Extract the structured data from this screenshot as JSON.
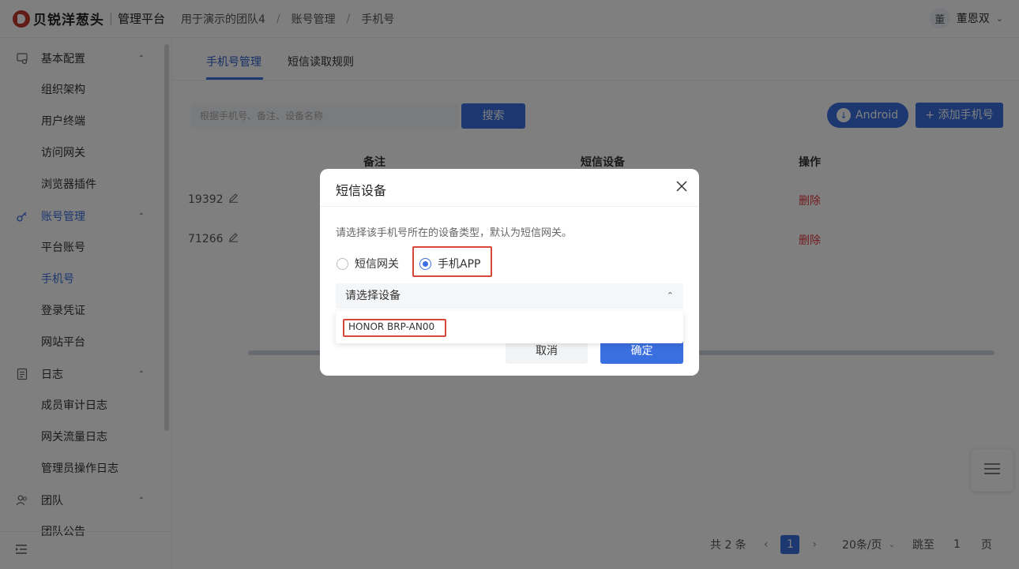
{
  "header": {
    "logo_text": "贝锐洋葱头",
    "logo_sub": "管理平台",
    "breadcrumbs": [
      "用于演示的团队4",
      "账号管理",
      "手机号"
    ],
    "user_avatar": "董",
    "user_name": "董恩双"
  },
  "sidebar": {
    "groups": [
      {
        "label": "基本配置",
        "icon": "settings-icon",
        "items": [
          "组织架构",
          "用户终端",
          "访问网关",
          "浏览器插件"
        ]
      },
      {
        "label": "账号管理",
        "icon": "key-icon",
        "items": [
          "平台账号",
          "手机号",
          "登录凭证",
          "网站平台"
        ]
      },
      {
        "label": "日志",
        "icon": "log-icon",
        "items": [
          "成员审计日志",
          "网关流量日志",
          "管理员操作日志"
        ]
      },
      {
        "label": "团队",
        "icon": "team-icon",
        "items": [
          "团队公告"
        ]
      }
    ],
    "active_group": "账号管理",
    "active_item": "手机号"
  },
  "main": {
    "tabs": [
      "手机号管理",
      "短信读取规则"
    ],
    "active_tab": "手机号管理",
    "search_placeholder": "根据手机号、备注、设备名称",
    "search_button": "搜索",
    "android_button": "Android",
    "add_button": "+ 添加手机号",
    "columns": [
      "备注",
      "短信设备",
      "操作"
    ],
    "rows": [
      {
        "phone_tail": "19392",
        "action": "删除"
      },
      {
        "phone_tail": "71266",
        "action": "删除"
      }
    ],
    "pagination": {
      "total": "共 2 条",
      "current": "1",
      "page_size": "20条/页",
      "jump_label": "跳至",
      "jump_value": "1",
      "page_suffix": "页"
    }
  },
  "modal": {
    "title": "短信设备",
    "description": "请选择该手机号所在的设备类型，默认为短信网关。",
    "options": [
      "短信网关",
      "手机APP"
    ],
    "selected_option": "手机APP",
    "select_placeholder": "请选择设备",
    "device_options": [
      "HONOR BRP-AN00"
    ],
    "cancel_label": "取消",
    "ok_label": "确定"
  },
  "colors": {
    "accent": "#3a6fe0",
    "danger": "#e0393e",
    "highlight": "#d9473b",
    "brand": "#c0392b"
  }
}
